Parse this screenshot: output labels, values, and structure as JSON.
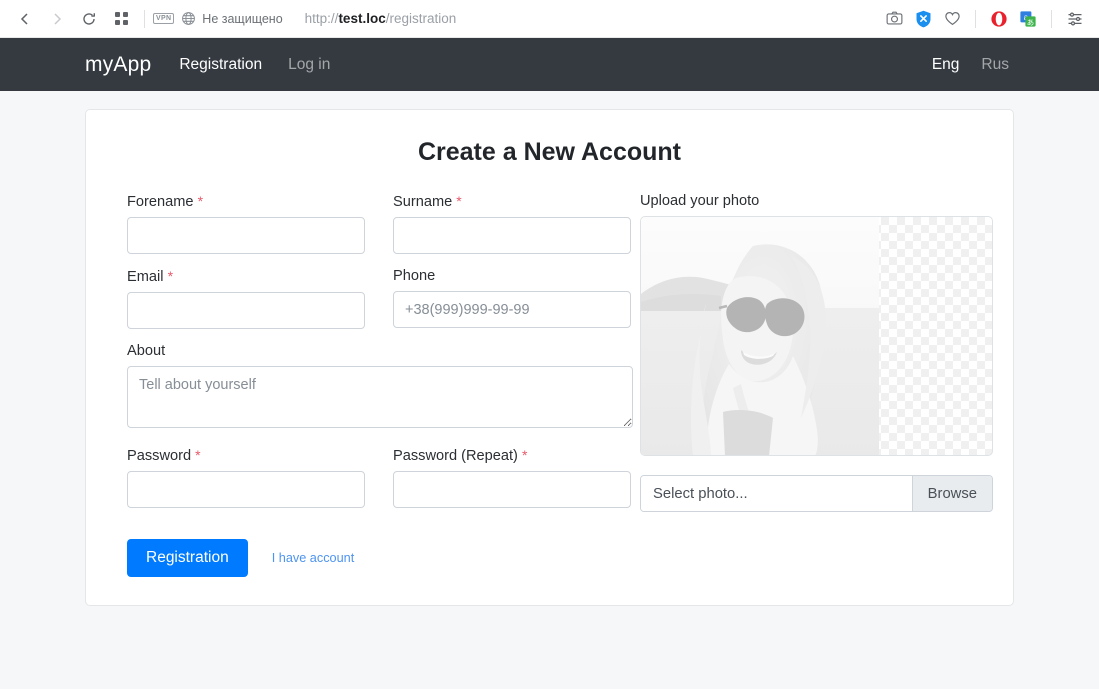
{
  "browser": {
    "back_icon": "back-arrow-icon",
    "forward_icon": "forward-arrow-icon",
    "reload_icon": "reload-icon",
    "tabs_icon": "grid-tiles-icon",
    "vpn_label": "VPN",
    "globe_icon": "globe-icon",
    "security_text": "Не защищено",
    "url_prefix": "http://",
    "url_host": "test.loc",
    "url_path": "/registration",
    "extensions": [
      {
        "name": "screenshot-camera-icon"
      },
      {
        "name": "adguard-shield-icon"
      },
      {
        "name": "heart-favorite-icon"
      },
      {
        "name": "opera-vpn-icon"
      },
      {
        "name": "translator-icon"
      },
      {
        "name": "easy-settings-icon"
      }
    ]
  },
  "navbar": {
    "brand": "myApp",
    "links": [
      {
        "label": "Registration",
        "active": true
      },
      {
        "label": "Log in",
        "active": false
      }
    ],
    "languages": [
      {
        "label": "Eng",
        "active": true
      },
      {
        "label": "Rus",
        "active": false
      }
    ],
    "background_color": "#343a40"
  },
  "form": {
    "title": "Create a New Account",
    "required_marker": "*",
    "fields": {
      "forename": {
        "label": "Forename",
        "required": true,
        "value": "",
        "placeholder": ""
      },
      "surname": {
        "label": "Surname",
        "required": true,
        "value": "",
        "placeholder": ""
      },
      "email": {
        "label": "Email",
        "required": true,
        "value": "",
        "placeholder": ""
      },
      "phone": {
        "label": "Phone",
        "required": false,
        "value": "",
        "placeholder": "+38(999)999-99-99"
      },
      "about": {
        "label": "About",
        "required": false,
        "value": "",
        "placeholder": "Tell about yourself"
      },
      "password": {
        "label": "Password",
        "required": true,
        "value": "",
        "placeholder": ""
      },
      "password_repeat": {
        "label": "Password (Repeat)",
        "required": true,
        "value": "",
        "placeholder": ""
      }
    },
    "submit_label": "Registration",
    "have_account_label": "I have account",
    "primary_color": "#007bff"
  },
  "upload": {
    "label": "Upload your photo",
    "preview_alt": "woman-in-sunglasses-photo",
    "file_name": "Select photo...",
    "browse_label": "Browse"
  }
}
